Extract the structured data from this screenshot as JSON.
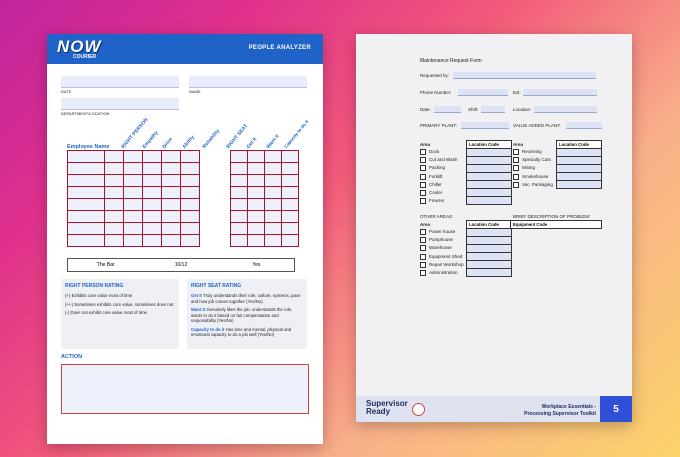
{
  "left_page": {
    "logo": "NOW",
    "logo_sub": "COURIER",
    "title": "PEOPLE ANALYZER",
    "fields": {
      "date": "DATE",
      "name": "NAME",
      "department": "DEPARTMENT/LOCATION"
    },
    "employee_name": "Employee Name",
    "right_person_cols": [
      "RIGHT PERSON",
      "Empathy",
      "Drive",
      "Ability",
      "Reliability"
    ],
    "right_seat_cols": [
      "RIGHT SEAT",
      "Get It",
      "Want It",
      "Capacity to do it"
    ],
    "bar": {
      "label": "The Bar",
      "score": "10/12",
      "answer": "Yes"
    },
    "right_person_rating": {
      "title": "RIGHT PERSON RATING",
      "items": [
        "(+) Exhibits core value most of time",
        "(+/-) Sometimes exhibits core value, sometimes does not",
        "(-) Does not exhibit core value most of time"
      ]
    },
    "right_seat_rating": {
      "title": "RIGHT SEAT RATING",
      "items": [
        {
          "term": "Get It",
          "text": "Truly understands their role, culture, systems, pace and how job comes together (Yes/No)"
        },
        {
          "term": "Want It",
          "text": "Genuinely likes the job, understands the role, wants to do it based on fair compensation and responsibility (Yes/No)"
        },
        {
          "term": "Capacity to do it",
          "text": "Has time and mental, physical and emotional capacity to do a job well (Yes/No)"
        }
      ]
    },
    "action": "ACTION"
  },
  "right_page": {
    "title": "Maintenance Request Form",
    "requested_by": "Requested by:",
    "phone": "Phone Number:",
    "ext": "Ext:",
    "date": "Date:",
    "shift": "Shift:",
    "location": "Location:",
    "primary_plant": "PRIMARY PLANT:",
    "value_added_plant": "VALUE ADDED PLANT:",
    "area": "Area",
    "location_code": "Location Code",
    "areas_left": [
      "Dock",
      "Cut and Wash",
      "Packing",
      "Forklift",
      "Chiller",
      "Cooler",
      "Freezer"
    ],
    "areas_right": [
      "Receiving",
      "Specialty Cuts",
      "Mixing",
      "Smokehouse",
      "Vac. Packaging"
    ],
    "other_areas": "OTHER AREAS:",
    "brief_description": "BRIEF DESCRIPTION OF PROBLEM:",
    "equipment_code": "Equipment Code",
    "areas_other": [
      "Power house",
      "Pumphouse",
      "Warehouse",
      "Equipment Shed",
      "Repair Workshop",
      "Administration"
    ],
    "footer": {
      "brand_line1": "Supervisor",
      "brand_line2": "Ready",
      "title_line1": "Workplace Essentials -",
      "title_line2": "Processing Supervisor Toolkit",
      "page": "5"
    }
  }
}
